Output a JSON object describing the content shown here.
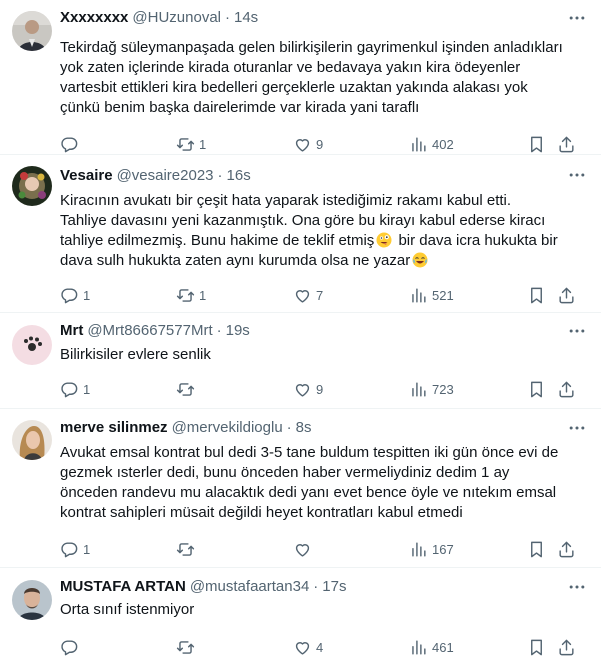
{
  "tweets": [
    {
      "name": "Xxxxxxxx",
      "handle": "@HUzunoval",
      "time": "14s",
      "lines": [
        "Tekirdağ süleymanpaşada gelen bilirkişilerin gayrimenkul işinden anladıkları",
        "yok zaten içlerinde kirada oturanlar ve bedavaya yakın kira ödeyenler",
        "vartesbit ettikleri kira bedelleri gerçeklerle uzaktan yakında alakası yok",
        "çünkü benim başka dairelerimde var kirada yani taraflı"
      ],
      "replies": "",
      "retweets": "1",
      "likes": "9",
      "views": "402"
    },
    {
      "name": "Vesaire",
      "handle": "@vesaire2023",
      "time": "16s",
      "lines": [
        "Kiracının avukatı bir çeşit hata yaparak istediğimiz rakamı kabul etti.",
        "Tahliye davasını yeni kazanmıştık. Ona göre bu kirayı kabul ederse kiracı",
        "tahliye edilmezmiş. Bunu hakime de teklif etmiş",
        " bir dava icra hukukta bir",
        "dava sulh hukukta zaten aynı kurumda olsa ne yazar"
      ],
      "replies": "1",
      "retweets": "1",
      "likes": "7",
      "views": "521"
    },
    {
      "name": "Mrt",
      "handle": "@Mrt86667577Mrt",
      "time": "19s",
      "lines": [
        "Bilirkisiler evlere senlik"
      ],
      "replies": "1",
      "retweets": "",
      "likes": "9",
      "views": "723"
    },
    {
      "name": "merve silinmez",
      "handle": "@mervekildioglu",
      "time": "8s",
      "lines": [
        "Avukat emsal kontrat bul dedi 3-5 tane buldum tespitten iki gün önce evi de",
        "gezmek ısterler dedi, bunu önceden haber vermeliydiniz dedim 1 ay",
        "önceden randevu mu alacaktık dedi yanı evet bence öyle ve nıtekım emsal",
        "kontrat sahipleri müsait değildi heyet kontratları kabul etmedi"
      ],
      "replies": "1",
      "retweets": "",
      "likes": "",
      "views": "167"
    },
    {
      "name": "MUSTAFA ARTAN",
      "handle": "@mustafaartan34",
      "time": "17s",
      "lines": [
        "Orta sınıf istenmiyor"
      ],
      "replies": "",
      "retweets": "",
      "likes": "4",
      "views": "461"
    }
  ],
  "separator": "·",
  "icons": {
    "reply": "reply-icon",
    "retweet": "retweet-icon",
    "like": "heart-icon",
    "views": "views-icon",
    "bookmark": "bookmark-icon",
    "share": "share-icon",
    "more": "more-icon"
  },
  "colors": {
    "text": "#0f1419",
    "secondary": "#536471",
    "divider": "#eff3f4"
  }
}
